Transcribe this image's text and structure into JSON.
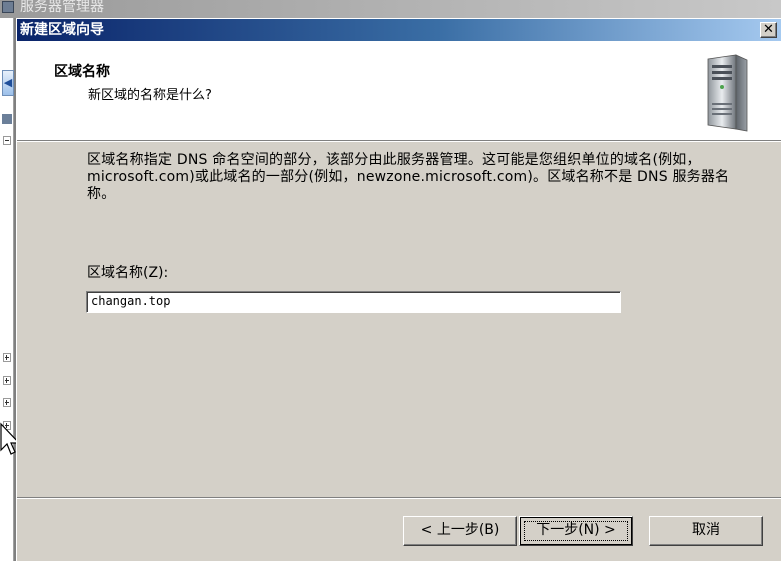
{
  "background": {
    "parent_window_title": "服务器管理器"
  },
  "dialog": {
    "title": "新建区域向导",
    "close_glyph": "✕",
    "header_title": "区域名称",
    "header_subtitle": "新区域的名称是什么?",
    "description": "区域名称指定 DNS 命名空间的部分，该部分由此服务器管理。这可能是您组织单位的域名(例如，microsoft.com)或此域名的一部分(例如，newzone.microsoft.com)。区域名称不是 DNS 服务器名称。",
    "zone_name_label": "区域名称(Z):",
    "zone_name_value": "changan.top",
    "buttons": {
      "back": "< 上一步(B)",
      "next": "下一步(N) >",
      "cancel": "取消"
    }
  },
  "colors": {
    "titlebar_start": "#0a246a",
    "titlebar_end": "#a6caf0",
    "dialog_bg": "#d4d0c8",
    "header_bg": "#ffffff"
  },
  "icons": {
    "server": "server-tower-icon",
    "close": "close-icon",
    "cursor": "mouse-pointer-icon"
  }
}
